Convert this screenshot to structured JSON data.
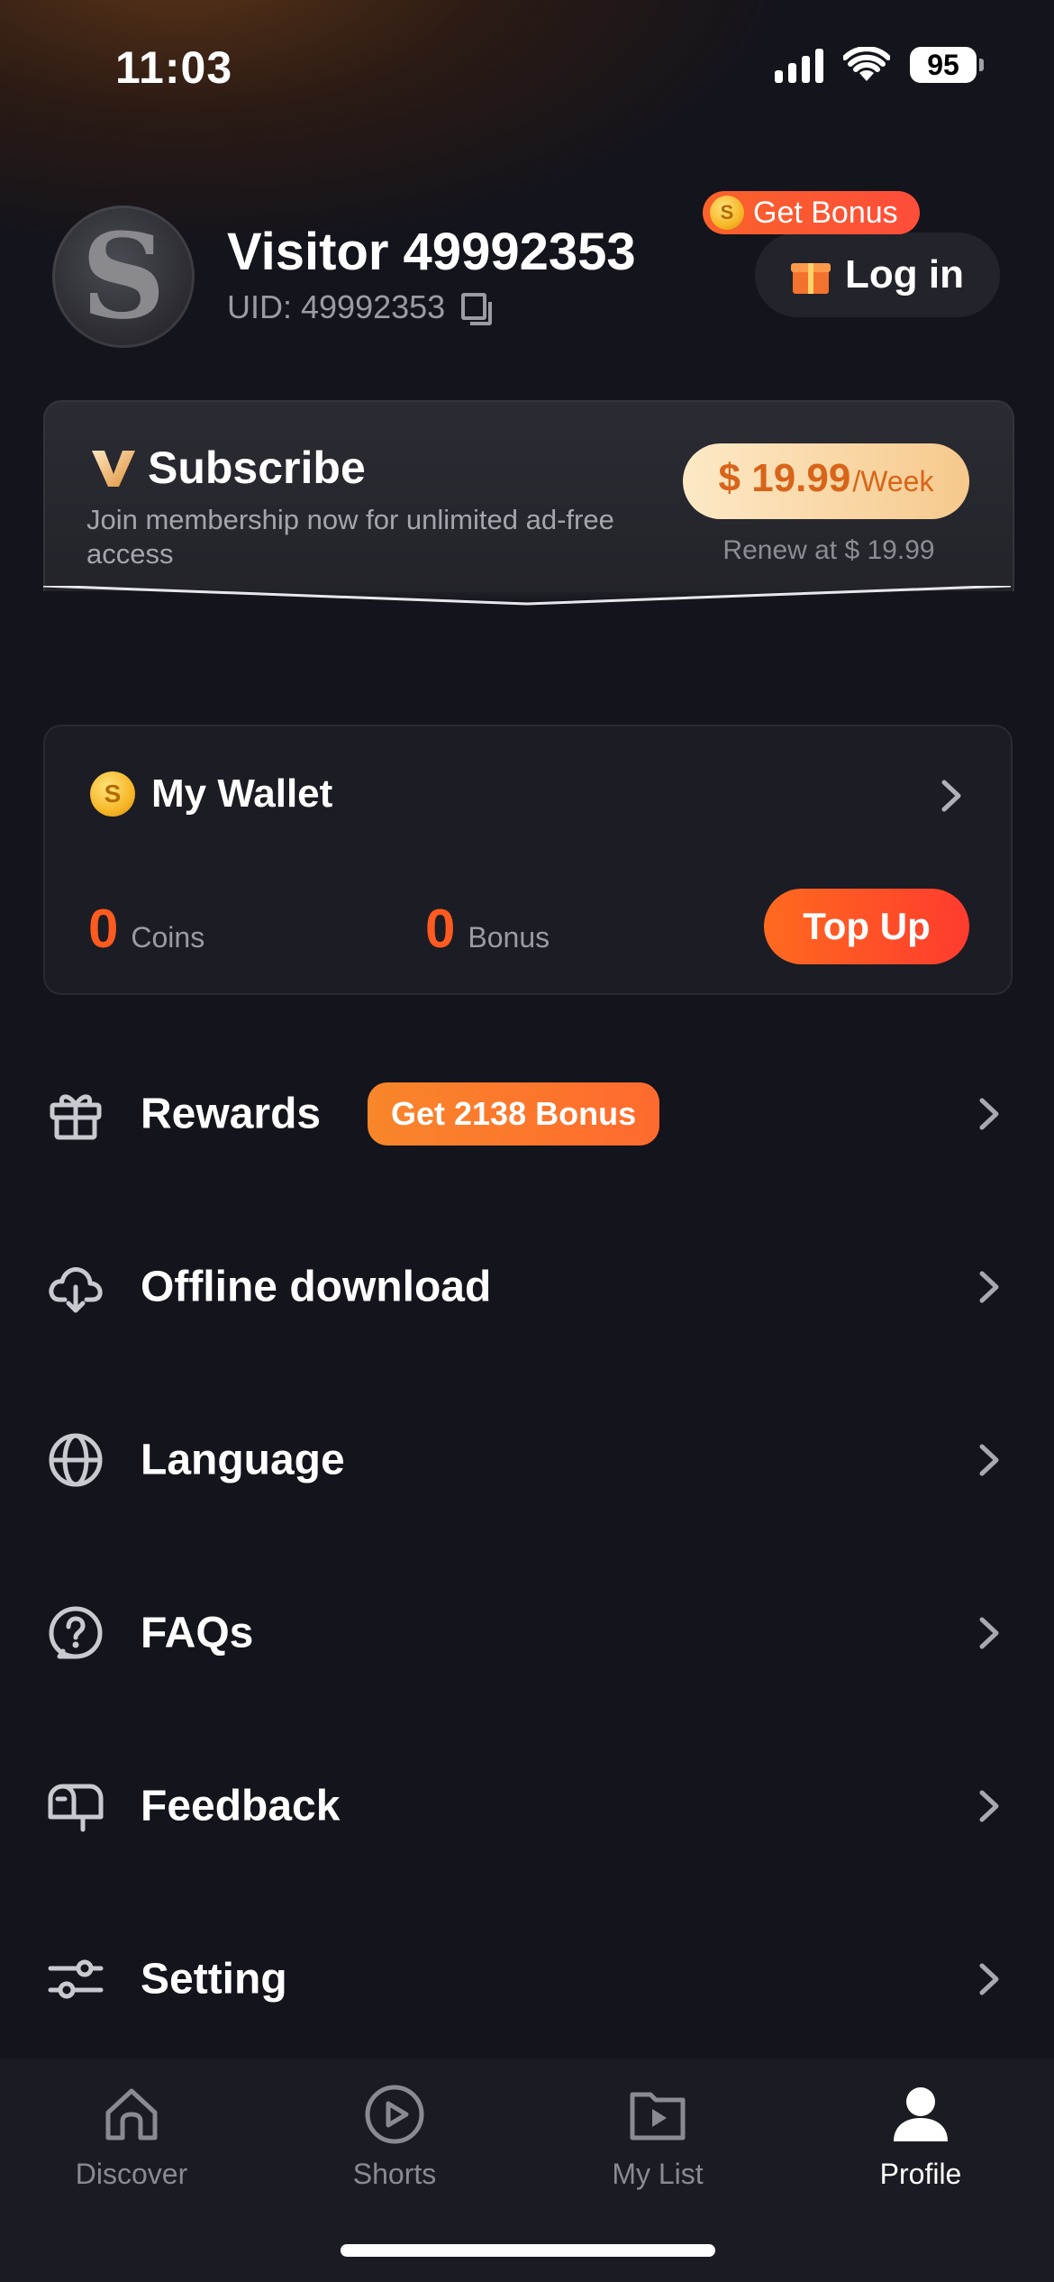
{
  "status_bar": {
    "time": "11:03",
    "battery": "95"
  },
  "profile": {
    "avatar_letter": "S",
    "username": "Visitor 49992353",
    "uid": "UID: 49992353",
    "login_label": "Log in",
    "bonus_badge": "Get Bonus"
  },
  "subscribe": {
    "title": "Subscribe",
    "description": "Join membership now for unlimited ad-free access",
    "price": "$ 19.99",
    "price_unit": "/Week",
    "renew": "Renew at $ 19.99"
  },
  "wallet": {
    "title": "My Wallet",
    "coins_value": "0",
    "coins_label": "Coins",
    "bonus_value": "0",
    "bonus_label": "Bonus",
    "topup_label": "Top Up"
  },
  "menu": {
    "items": [
      {
        "label": "Rewards",
        "icon": "gift-icon",
        "badge": "Get 2138 Bonus"
      },
      {
        "label": "Offline download",
        "icon": "cloud-download-icon"
      },
      {
        "label": "Language",
        "icon": "globe-icon"
      },
      {
        "label": "FAQs",
        "icon": "question-icon"
      },
      {
        "label": "Feedback",
        "icon": "mailbox-icon"
      },
      {
        "label": "Setting",
        "icon": "sliders-icon"
      }
    ]
  },
  "tabs": [
    {
      "label": "Discover",
      "icon": "home-icon"
    },
    {
      "label": "Shorts",
      "icon": "play-circle-icon"
    },
    {
      "label": "My List",
      "icon": "folder-play-icon"
    },
    {
      "label": "Profile",
      "icon": "person-icon",
      "active": true
    }
  ],
  "colors": {
    "accent": "#ff5a1f",
    "background": "#14141c",
    "price_gold": "#f6c98c"
  }
}
